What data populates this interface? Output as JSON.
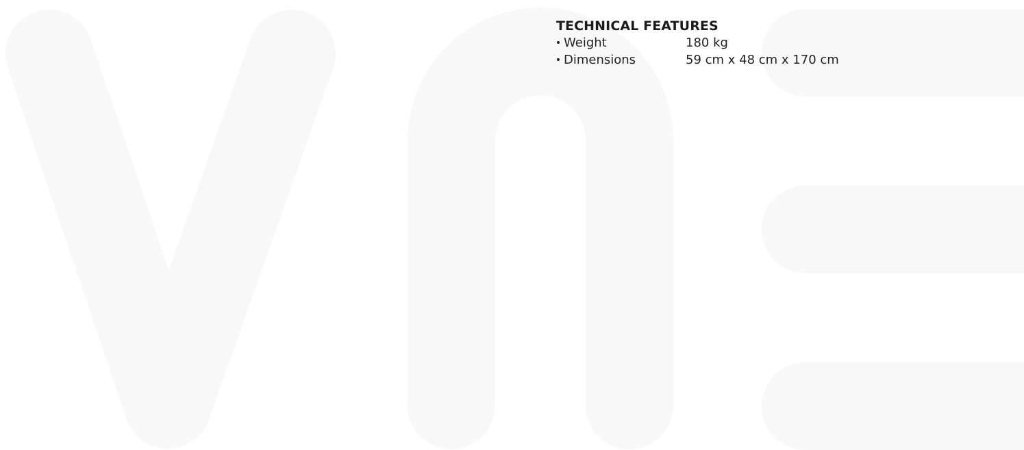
{
  "technical_features": {
    "title": "TECHNICAL FEATURES",
    "specs": [
      {
        "label": "Weight",
        "value": "180 kg"
      },
      {
        "label": "Dimensions",
        "value": "59 cm x 48 cm x 170 cm"
      }
    ]
  },
  "colors": {
    "background": "#ffffff",
    "watermark": "#f8f8f8",
    "text": "#222222"
  }
}
